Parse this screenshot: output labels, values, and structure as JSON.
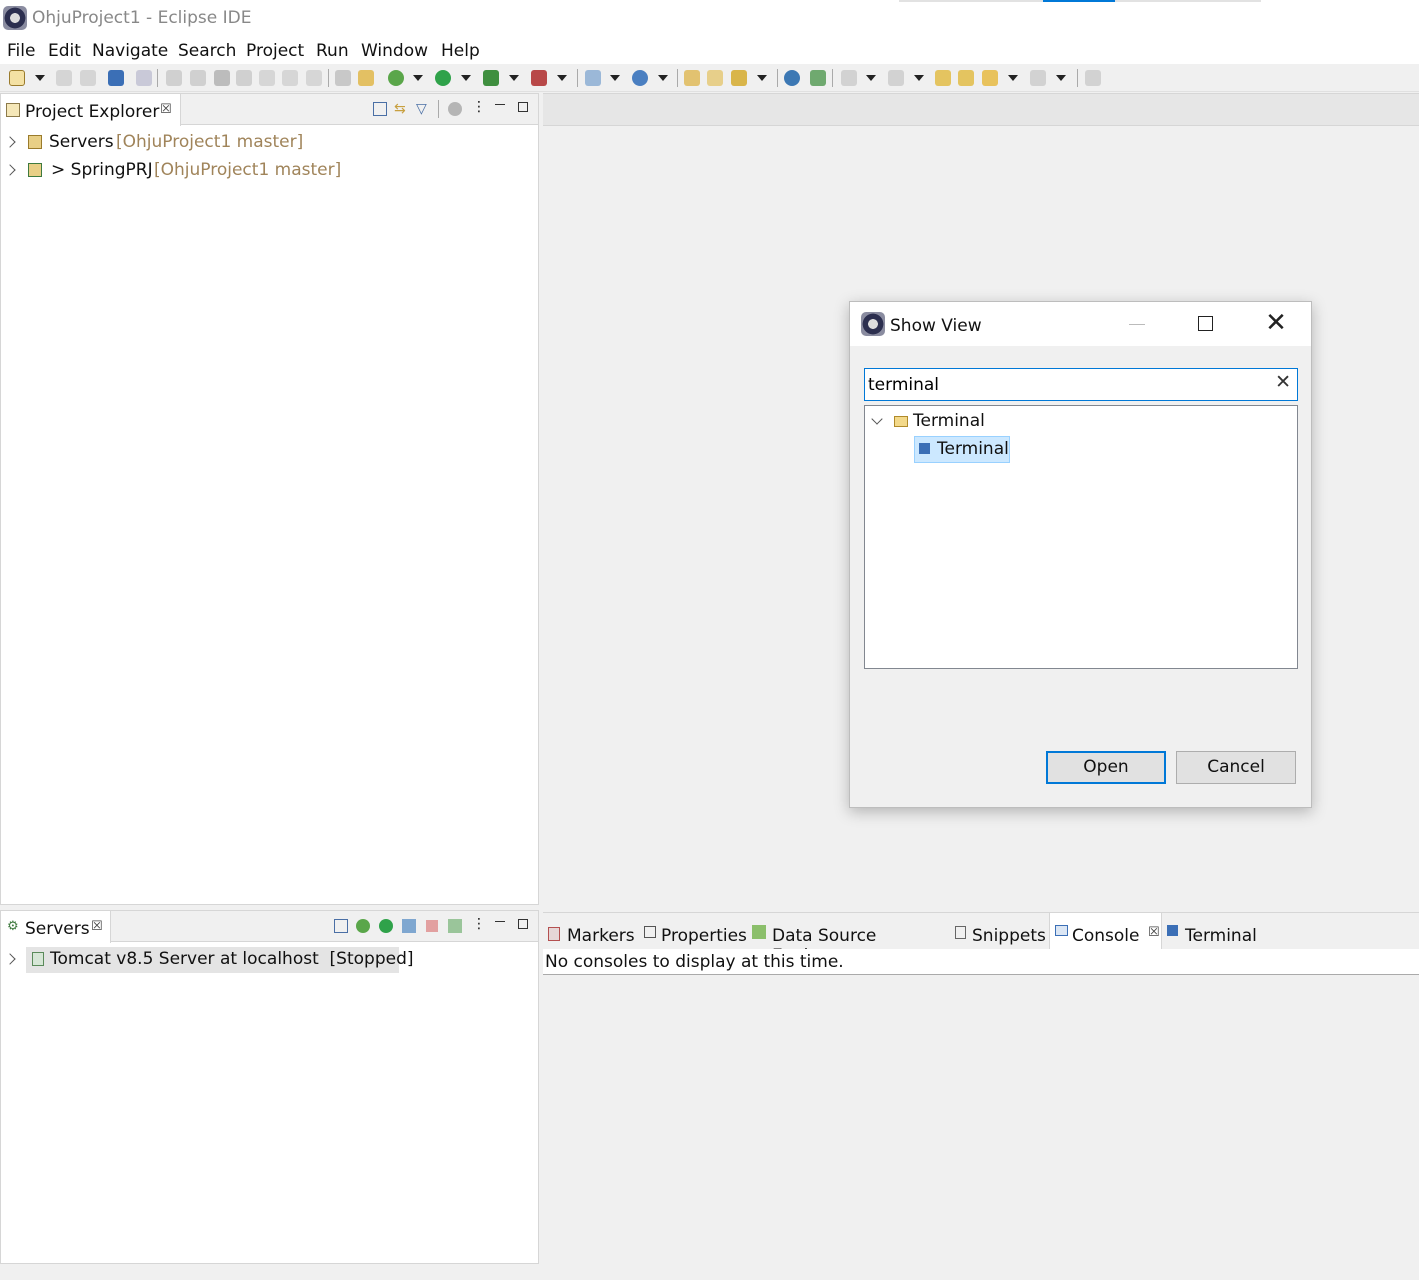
{
  "window": {
    "title": "OhjuProject1 - Eclipse IDE"
  },
  "menu": [
    "File",
    "Edit",
    "Navigate",
    "Search",
    "Project",
    "Run",
    "Window",
    "Help"
  ],
  "project_explorer": {
    "tab_label": "Project Explorer",
    "items": [
      {
        "name": "Servers",
        "decoration": "[OhjuProject1 master]"
      },
      {
        "name": "> SpringPRJ",
        "decoration": "[OhjuProject1 master]"
      }
    ]
  },
  "servers_view": {
    "tab_label": "Servers",
    "items": [
      {
        "label": "Tomcat v8.5 Server at localhost  [Stopped]"
      }
    ]
  },
  "bottom_tabs": {
    "markers": "Markers",
    "properties": "Properties",
    "data_source": "Data Source Explorer",
    "snippets": "Snippets",
    "console": "Console",
    "terminal": "Terminal"
  },
  "console": {
    "message": "No consoles to display at this time."
  },
  "dialog": {
    "title": "Show View",
    "filter_value": "terminal",
    "tree": {
      "category": "Terminal",
      "child": "Terminal"
    },
    "open_label": "Open",
    "cancel_label": "Cancel"
  },
  "colors": {
    "accent": "#0078d7",
    "decoration": "#a0845a",
    "selection": "#cce8ff"
  }
}
